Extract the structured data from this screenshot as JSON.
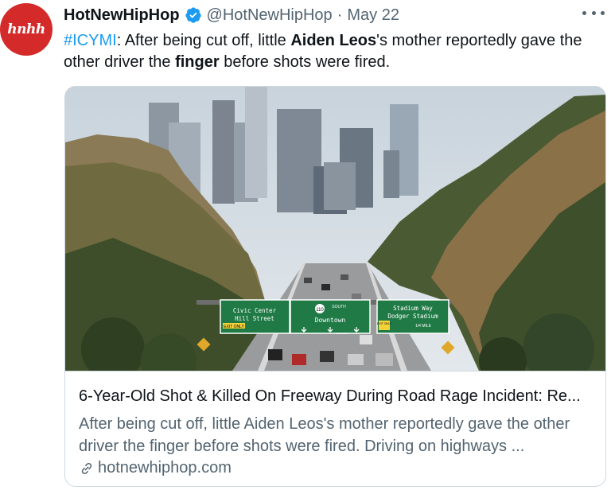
{
  "tweet": {
    "avatar_text": "hnhh",
    "author_name": "HotNewHipHop",
    "handle": "@HotNewHipHop",
    "separator": "·",
    "date": "May 22",
    "text": {
      "hashtag": "#ICYMI",
      "part1": ": After being cut off, little ",
      "bold1": "Aiden Leos",
      "part2": "'s mother reportedly gave the other driver the ",
      "bold2": "finger",
      "part3": " before shots were fired."
    }
  },
  "card": {
    "title": "6-Year-Old Shot & Killed On Freeway During Road Rage Incident: Re...",
    "description": "After being cut off, little Aiden Leos's mother reportedly gave the other driver the finger before shots were fired. Driving on highways ...",
    "domain": "hotnewhiphop.com",
    "signs": {
      "left_line1": "Civic Center",
      "left_line2": "Hill Street",
      "left_exit": "EXIT ONLY",
      "route_number": "110",
      "route_dir": "SOUTH",
      "middle": "Downtown",
      "right_line1": "Stadium Way",
      "right_line2": "Dodger Stadium",
      "right_exit": "EXIT ONLY",
      "right_mile": "1/4 MILE"
    }
  },
  "colors": {
    "accent": "#1d9bf0",
    "avatar_bg": "#d42a2a",
    "secondary_text": "#536471",
    "sign_green": "#1f7a45"
  }
}
